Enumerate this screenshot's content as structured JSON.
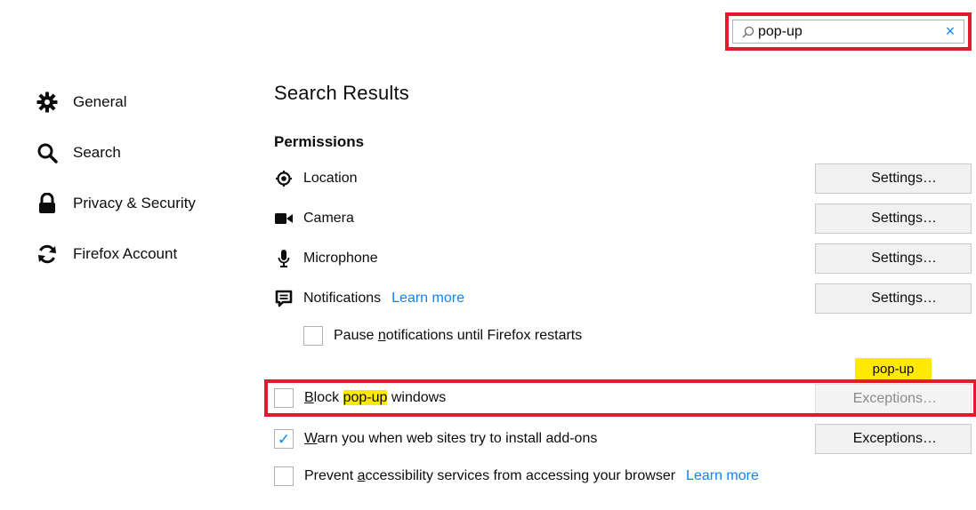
{
  "search": {
    "value": "pop-up",
    "clear_label": "×"
  },
  "sidebar": {
    "items": [
      {
        "label": "General",
        "icon": "gear-icon"
      },
      {
        "label": "Search",
        "icon": "search-icon"
      },
      {
        "label": "Privacy & Security",
        "icon": "lock-icon"
      },
      {
        "label": "Firefox Account",
        "icon": "sync-icon"
      }
    ]
  },
  "main": {
    "title": "Search Results",
    "section_title": "Permissions",
    "permissions": [
      {
        "label": "Location",
        "icon": "location-icon",
        "button": "Settings…"
      },
      {
        "label": "Camera",
        "icon": "camera-icon",
        "button": "Settings…"
      },
      {
        "label": "Microphone",
        "icon": "microphone-icon",
        "button": "Settings…"
      },
      {
        "label": "Notifications",
        "icon": "notifications-icon",
        "button": "Settings…",
        "link": "Learn more"
      }
    ],
    "pause_notifications": {
      "pre": "Pause ",
      "accel": "n",
      "post": "otifications until Firefox restarts",
      "checked": false
    },
    "tooltip": "pop-up",
    "block_popups": {
      "accel": "B",
      "pre": "lock ",
      "highlight": "pop-up",
      "post": " windows",
      "checked": false,
      "button": "Exceptions…"
    },
    "warn_addons": {
      "accel": "W",
      "post": "arn you when web sites try to install add-ons",
      "checked": true,
      "check_glyph": "✓",
      "button": "Exceptions…"
    },
    "prevent_accessibility": {
      "pre": "Prevent ",
      "accel": "a",
      "post": "ccessibility services from accessing your browser",
      "checked": false,
      "link": "Learn more"
    }
  },
  "colors": {
    "accent": "#0a84ff",
    "highlight": "#ffe900",
    "annotation": "#e21a2c"
  }
}
